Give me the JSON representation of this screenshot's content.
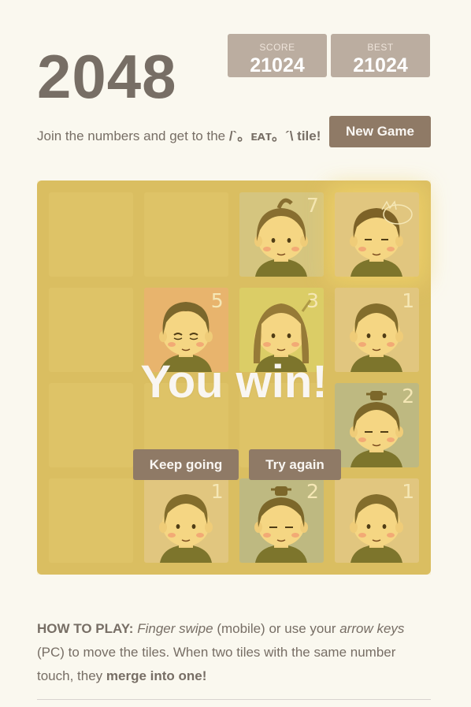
{
  "header": {
    "title": "2048",
    "score_label": "SCORE",
    "score_value": "21024",
    "best_label": "BEST",
    "best_value": "21024"
  },
  "intro": {
    "prefix": "Join the numbers and get to the ",
    "target": "/`。ᴇᴀᴛ。´\\ tile!",
    "new_game_label": "New Game"
  },
  "board": {
    "tiles": [
      {
        "row": 0,
        "col": 2,
        "num": "7",
        "bg": "#d2c58a",
        "face": "long-hair",
        "icon": "long-hair-chibi-icon"
      },
      {
        "row": 0,
        "col": 3,
        "num": "",
        "bg": "#e0c68a",
        "face": "cat",
        "icon": "cat-doodle-chibi-icon"
      },
      {
        "row": 1,
        "col": 1,
        "num": "5",
        "bg": "#e7b276",
        "face": "tired",
        "icon": "tired-chibi-icon"
      },
      {
        "row": 1,
        "col": 2,
        "num": "3",
        "bg": "#d9cf6e",
        "face": "braided",
        "icon": "braided-chibi-icon"
      },
      {
        "row": 1,
        "col": 3,
        "num": "1",
        "bg": "#e0c68a",
        "face": "plain",
        "icon": "plain-chibi-icon"
      },
      {
        "row": 2,
        "col": 3,
        "num": "2",
        "bg": "#b8b88d",
        "face": "topknot",
        "icon": "topknot-chibi-icon"
      },
      {
        "row": 3,
        "col": 1,
        "num": "1",
        "bg": "#e0c68a",
        "face": "plain",
        "icon": "plain-chibi-icon"
      },
      {
        "row": 3,
        "col": 2,
        "num": "2",
        "bg": "#b8b88d",
        "face": "topknot",
        "icon": "topknot-chibi-icon"
      },
      {
        "row": 3,
        "col": 3,
        "num": "1",
        "bg": "#e0c68a",
        "face": "plain",
        "icon": "plain-chibi-icon"
      }
    ],
    "win_message": "You win!",
    "keep_going_label": "Keep going",
    "try_again_label": "Try again"
  },
  "howto": {
    "lead": "HOW TO PLAY:",
    "swipe": "Finger swipe",
    "t1": " (mobile) or use your ",
    "keys": "arrow keys",
    "t2": " (PC) to move the tiles. When two tiles with the same number touch, they ",
    "merge": "merge into one!"
  },
  "colors": {
    "background": "#faf8ef",
    "board": "#d8bd68",
    "button": "#8f7a66",
    "score_box": "#bbada0",
    "text": "#776e65"
  }
}
